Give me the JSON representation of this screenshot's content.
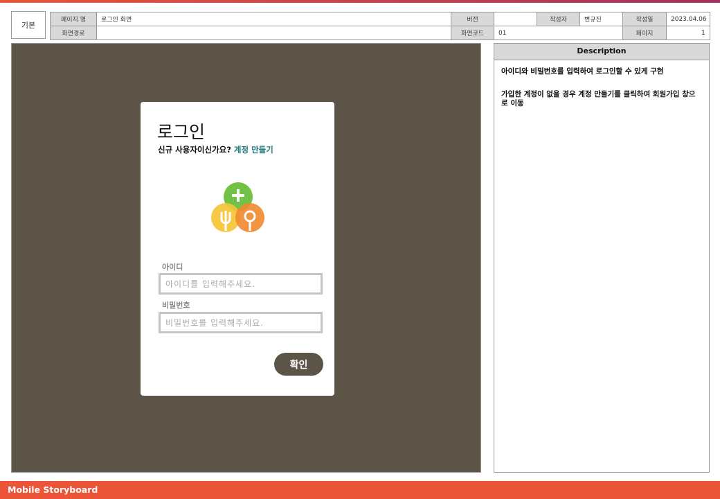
{
  "header": {
    "kind": "기본",
    "page_name_label": "페이지 명",
    "page_name": "로그인 화면",
    "version_label": "버전",
    "version": "",
    "author_label": "작성자",
    "author": "변규진",
    "date_label": "작성일",
    "date": "2023.04.06",
    "path_label": "화면경로",
    "path": "",
    "screen_code_label": "화면코드",
    "screen_code": "01",
    "page_label": "페이지",
    "page": "1"
  },
  "login": {
    "title": "로그인",
    "signup_prompt": "신규 사용자이신가요?",
    "signup_link": "계정 만들기",
    "id_label": "아이디",
    "id_placeholder": "아이디를 입력해주세요.",
    "id_value": "",
    "pw_label": "비밀번호",
    "pw_placeholder": "비밀번호를 입력해주세요.",
    "pw_value": "",
    "confirm_label": "확인",
    "logo_icon": "fork-spoon-plus-logo-icon"
  },
  "description": {
    "title": "Description",
    "lines": [
      "아이디와 비밀번호를 입력하여 로그인할 수 있게 구현",
      "가입한 계정이 없을 경우 계정 만들기를 클릭하여 회원가입 창으로 이동"
    ]
  },
  "footer": {
    "label": "Mobile Storyboard"
  },
  "colors": {
    "canvas_bg": "#5c5447",
    "footer_bg": "#ec5538",
    "link": "#1f7a7a",
    "logo_green": "#6cbf3e",
    "logo_yellow": "#f5c437",
    "logo_orange": "#f18a2f"
  }
}
